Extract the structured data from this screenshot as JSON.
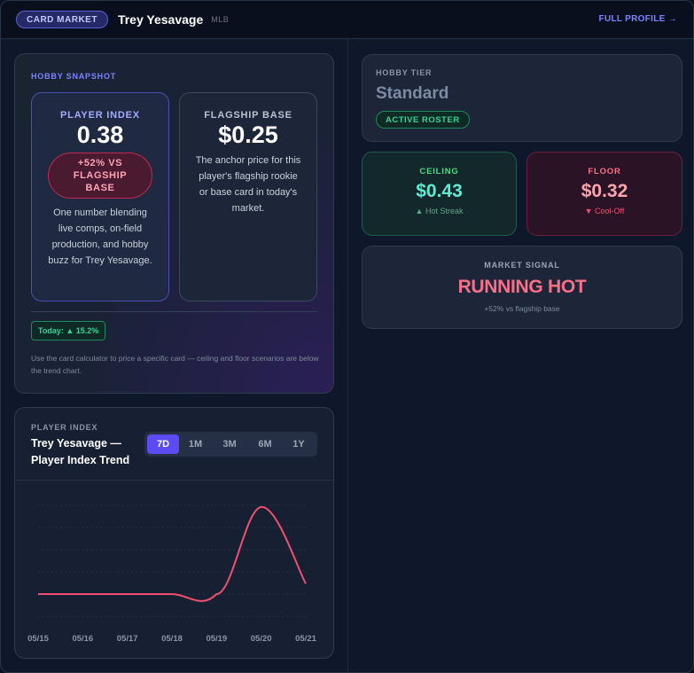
{
  "header": {
    "badge": "CARD MARKET",
    "player_name": "Trey Yesavage",
    "league": "MLB",
    "full_profile": "FULL PROFILE →"
  },
  "snapshot": {
    "label": "HOBBY SNAPSHOT",
    "player_index": {
      "title": "PLAYER INDEX",
      "value": "0.38",
      "badge": "+52% VS FLAGSHIP BASE",
      "description": "One number blending live comps, on-field production, and hobby buzz for Trey Yesavage."
    },
    "flagship_base": {
      "title": "FLAGSHIP BASE",
      "value": "$0.25",
      "description": "The anchor price for this player's flagship rookie or base card in today's market."
    },
    "today": "Today: ▲ 15.2%",
    "note": "Use the card calculator to price a specific card — ceiling and floor scenarios are below the trend chart."
  },
  "trend": {
    "label": "PLAYER INDEX",
    "title": "Trey Yesavage — Player Index Trend",
    "tabs": [
      {
        "label": "7D",
        "active": true
      },
      {
        "label": "1M",
        "active": false
      },
      {
        "label": "3M",
        "active": false
      },
      {
        "label": "6M",
        "active": false
      },
      {
        "label": "1Y",
        "active": false
      }
    ]
  },
  "chart_data": {
    "type": "line",
    "x": [
      "05/15",
      "05/16",
      "05/17",
      "05/18",
      "05/19",
      "05/20",
      "05/21"
    ],
    "series": [
      {
        "values": [
          0.0,
          0.0,
          0.0,
          0.0,
          0.0,
          1.0,
          0.12
        ],
        "color": "#f0506e"
      }
    ],
    "ylim": [
      0,
      1.15
    ],
    "grid": true
  },
  "tier": {
    "label": "HOBBY TIER",
    "value": "Standard",
    "badge": "ACTIVE ROSTER"
  },
  "ceiling": {
    "title": "CEILING",
    "value": "$0.43",
    "sub": "▲ Hot Streak"
  },
  "floor": {
    "title": "FLOOR",
    "value": "$0.32",
    "sub": "▼ Cool-Off"
  },
  "signal": {
    "title": "MARKET SIGNAL",
    "value": "RUNNING HOT",
    "sub": "+52% vs flagship base"
  },
  "colors": {
    "accent": "#5b4bf0",
    "positive": "#34d399",
    "negative": "#f0506e"
  }
}
